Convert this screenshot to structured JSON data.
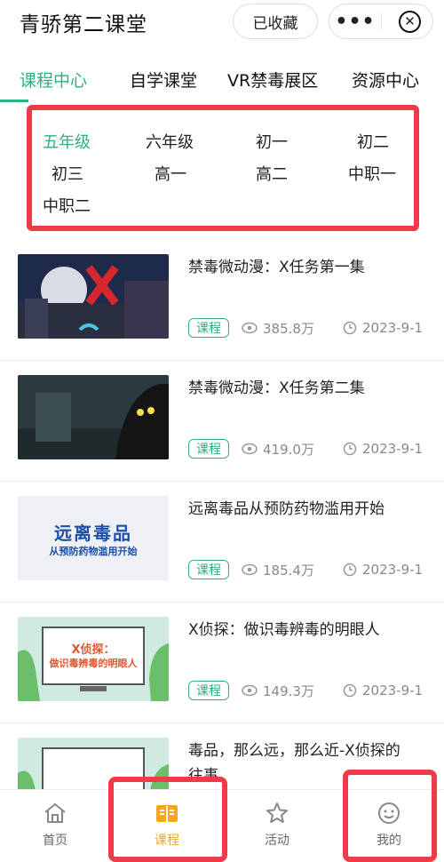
{
  "header": {
    "title": "青骄第二课堂",
    "favorite_label": "已收藏",
    "more_icon": "more-dots-icon",
    "close_icon": "close-circle-icon"
  },
  "tabs": [
    {
      "label": "课程中心",
      "active": true
    },
    {
      "label": "自学课堂",
      "active": false
    },
    {
      "label": "VR禁毒展区",
      "active": false
    },
    {
      "label": "资源中心",
      "active": false
    }
  ],
  "grades": [
    {
      "label": "五年级",
      "active": true
    },
    {
      "label": "六年级",
      "active": false
    },
    {
      "label": "初一",
      "active": false
    },
    {
      "label": "初二",
      "active": false
    },
    {
      "label": "初三",
      "active": false
    },
    {
      "label": "高一",
      "active": false
    },
    {
      "label": "高二",
      "active": false
    },
    {
      "label": "中职一",
      "active": false
    },
    {
      "label": "中职二",
      "active": false
    }
  ],
  "courses": [
    {
      "title": "禁毒微动漫：X任务第一集",
      "badge": "课程",
      "views": "385.8万",
      "date": "2023-9-1"
    },
    {
      "title": "禁毒微动漫：X任务第二集",
      "badge": "课程",
      "views": "419.0万",
      "date": "2023-9-1"
    },
    {
      "title": "远离毒品从预防药物滥用开始",
      "badge": "课程",
      "views": "185.4万",
      "date": "2023-9-1",
      "thumb_text": "远离毒品",
      "thumb_sub": "从预防药物滥用开始"
    },
    {
      "title": "X侦探：做识毒辨毒的明眼人",
      "badge": "课程",
      "views": "149.3万",
      "date": "2023-9-1",
      "thumb_text": "X侦探：",
      "thumb_sub": "做识毒辨毒的明眼人"
    },
    {
      "title": "毒品，那么远，那么近-X侦探的",
      "title2": "往事"
    }
  ],
  "bottom_nav": [
    {
      "label": "首页",
      "icon": "home-icon",
      "active": false
    },
    {
      "label": "课程",
      "icon": "course-book-icon",
      "active": true
    },
    {
      "label": "活动",
      "icon": "star-icon",
      "active": false
    },
    {
      "label": "我的",
      "icon": "profile-smile-icon",
      "active": false
    }
  ],
  "colors": {
    "accent_green": "#2fb07c",
    "highlight_red": "#ee3b48",
    "nav_active": "#f5a623"
  }
}
